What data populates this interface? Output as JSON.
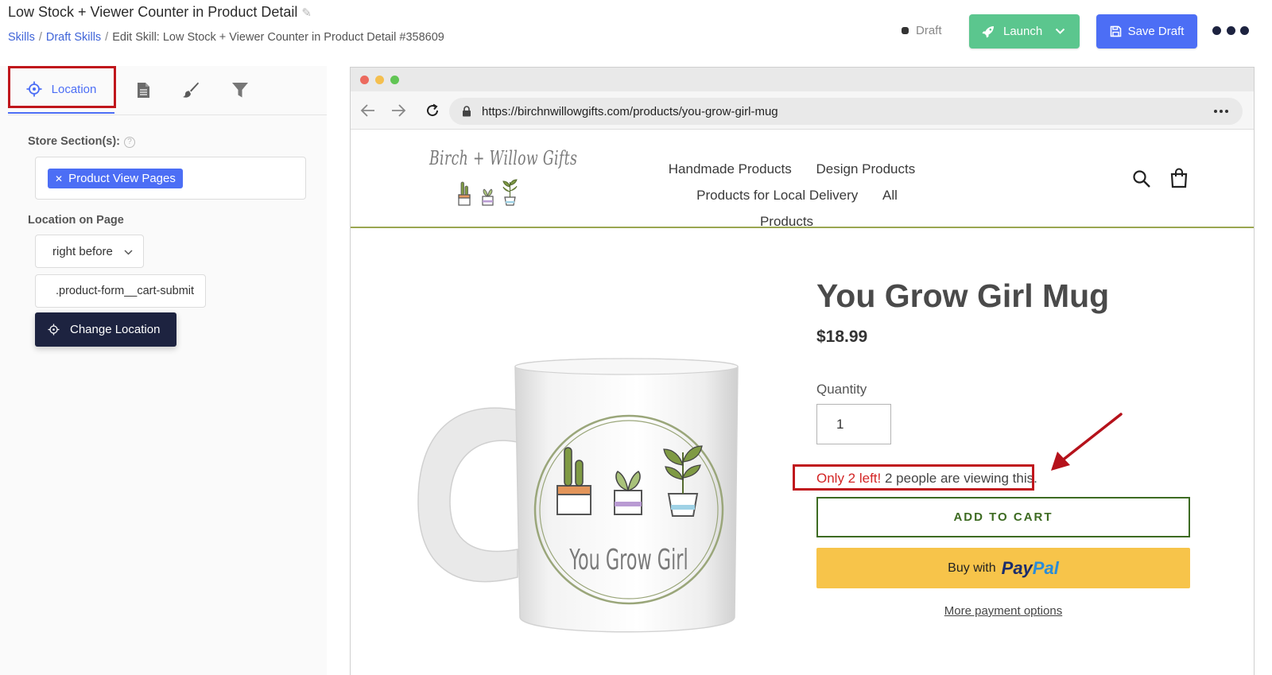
{
  "header": {
    "title": "Low Stock + Viewer Counter in Product Detail",
    "breadcrumb": {
      "skills": "Skills",
      "draft_skills": "Draft Skills",
      "current": "Edit Skill: Low Stock + Viewer Counter in Product Detail #358609"
    },
    "status": "Draft",
    "launch_label": "Launch",
    "save_label": "Save Draft"
  },
  "sidebar": {
    "tabs": [
      {
        "label": "Location",
        "icon": "crosshair-icon",
        "active": true
      },
      {
        "label": "",
        "icon": "document-icon"
      },
      {
        "label": "",
        "icon": "brush-icon"
      },
      {
        "label": "",
        "icon": "filter-icon"
      }
    ],
    "store_sections_label": "Store Section(s):",
    "help_glyph": "?",
    "store_section_chip": "Product View Pages",
    "location_on_page_label": "Location on Page",
    "position_value": "right before",
    "selector_value": ".product-form__cart-submit",
    "change_location_label": "Change Location"
  },
  "browser": {
    "url": "https://birchnwillowgifts.com/products/you-grow-girl-mug"
  },
  "store": {
    "logo_text": "Birch + Willow Gifts",
    "nav": {
      "row1": [
        "Handmade Products",
        "Design Products"
      ],
      "row2": [
        "Products for Local Delivery",
        "All Products"
      ]
    },
    "product": {
      "title": "You Grow Girl Mug",
      "price": "$18.99",
      "quantity_label": "Quantity",
      "quantity_value": "1",
      "low_stock_text": "Only 2 left!",
      "viewers_text": " 2 people are viewing this.",
      "add_to_cart": "ADD TO CART",
      "buy_with": "Buy with",
      "paypal_pay": "Pay",
      "paypal_pal": "Pal",
      "more_payment": "More payment options",
      "mug_text": "You Grow Girl"
    }
  },
  "colors": {
    "accent": "#4c6ef5",
    "launch": "#5bc68e",
    "dark": "#1d2340",
    "highlight_red": "#c0161c",
    "stock_red": "#d32525",
    "paypal_yellow": "#f7c44a"
  }
}
